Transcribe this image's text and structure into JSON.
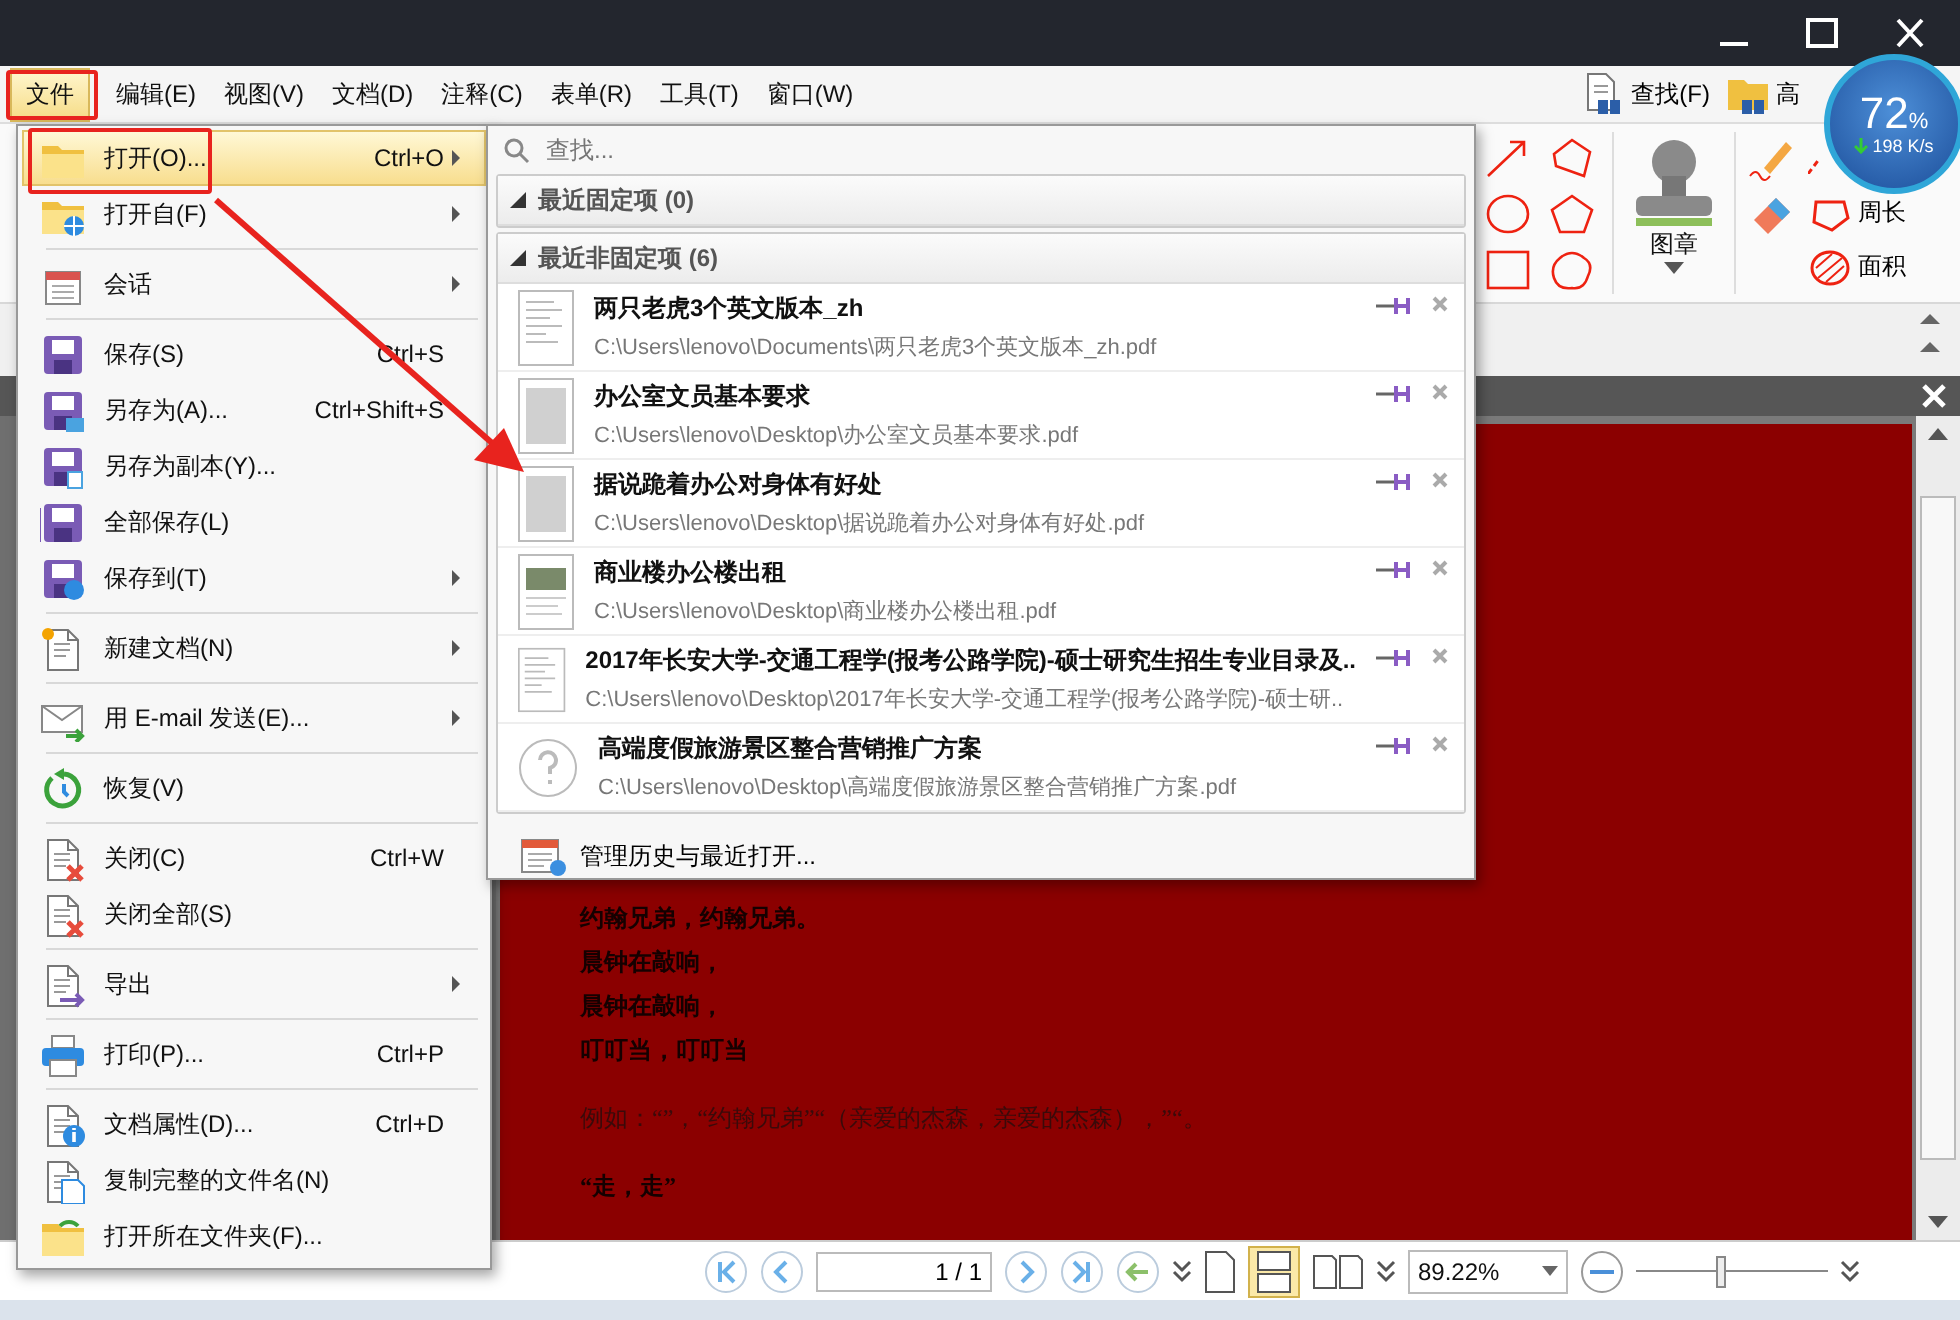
{
  "monitor": {
    "value": "72",
    "unit": "%",
    "speed": "198 K/s"
  },
  "menubar": [
    {
      "label": "文件",
      "selected": true
    },
    {
      "label": "编辑(E)",
      "selected": false
    },
    {
      "label": "视图(V)",
      "selected": false
    },
    {
      "label": "文档(D)",
      "selected": false
    },
    {
      "label": "注释(C)",
      "selected": false
    },
    {
      "label": "表单(R)",
      "selected": false
    },
    {
      "label": "工具(T)",
      "selected": false
    },
    {
      "label": "窗口(W)",
      "selected": false
    }
  ],
  "quick_tools": [
    {
      "label": "查找(F)"
    },
    {
      "label": "高"
    }
  ],
  "ribbon": {
    "stamp_label": "图章",
    "measure_labels": [
      "周长",
      "面积"
    ]
  },
  "file_menu": {
    "items": [
      {
        "kind": "item",
        "label": "打开(O)...",
        "shortcut": "Ctrl+O",
        "submenu": true,
        "selected": true
      },
      {
        "kind": "item",
        "label": "打开自(F)",
        "submenu": true,
        "selected": false
      },
      {
        "kind": "separator"
      },
      {
        "kind": "item",
        "label": "会话",
        "submenu": true,
        "selected": false
      },
      {
        "kind": "separator"
      },
      {
        "kind": "item",
        "label": "保存(S)",
        "shortcut": "Ctrl+S",
        "submenu": false,
        "selected": false
      },
      {
        "kind": "item",
        "label": "另存为(A)...",
        "shortcut": "Ctrl+Shift+S",
        "submenu": false,
        "selected": false
      },
      {
        "kind": "item",
        "label": "另存为副本(Y)...",
        "submenu": false,
        "selected": false
      },
      {
        "kind": "item",
        "label": "全部保存(L)",
        "submenu": false,
        "selected": false
      },
      {
        "kind": "item",
        "label": "保存到(T)",
        "submenu": true,
        "selected": false
      },
      {
        "kind": "separator"
      },
      {
        "kind": "item",
        "label": "新建文档(N)",
        "submenu": true,
        "selected": false
      },
      {
        "kind": "separator"
      },
      {
        "kind": "item",
        "label": "用 E-mail 发送(E)...",
        "submenu": true,
        "selected": false
      },
      {
        "kind": "separator"
      },
      {
        "kind": "item",
        "label": "恢复(V)",
        "submenu": false,
        "selected": false
      },
      {
        "kind": "separator"
      },
      {
        "kind": "item",
        "label": "关闭(C)",
        "shortcut": "Ctrl+W",
        "submenu": false,
        "selected": false
      },
      {
        "kind": "item",
        "label": "关闭全部(S)",
        "submenu": false,
        "selected": false
      },
      {
        "kind": "separator"
      },
      {
        "kind": "item",
        "label": "导出",
        "submenu": true,
        "selected": false
      },
      {
        "kind": "separator"
      },
      {
        "kind": "item",
        "label": "打印(P)...",
        "shortcut": "Ctrl+P",
        "submenu": false,
        "selected": false
      },
      {
        "kind": "separator"
      },
      {
        "kind": "item",
        "label": "文档属性(D)...",
        "shortcut": "Ctrl+D",
        "submenu": false,
        "selected": false
      },
      {
        "kind": "item",
        "label": "复制完整的文件名(N)",
        "submenu": false,
        "selected": false
      },
      {
        "kind": "item",
        "label": "打开所在文件夹(F)...",
        "submenu": false,
        "selected": false
      }
    ]
  },
  "recent_menu": {
    "search_placeholder": "查找...",
    "groups": [
      {
        "label": "最近固定项 (0)",
        "expanded": true
      },
      {
        "label": "最近非固定项 (6)",
        "expanded": true
      }
    ],
    "files": [
      {
        "name": "两只老虎3个英文版本_zh",
        "path": "C:\\Users\\lenovo\\Documents\\两只老虎3个英文版本_zh.pdf",
        "kind": "text"
      },
      {
        "name": "办公室文员基本要求",
        "path": "C:\\Users\\lenovo\\Desktop\\办公室文员基本要求.pdf",
        "kind": "dense"
      },
      {
        "name": "据说跪着办公对身体有好处",
        "path": "C:\\Users\\lenovo\\Desktop\\据说跪着办公对身体有好处.pdf",
        "kind": "dense"
      },
      {
        "name": "商业楼办公楼出租",
        "path": "C:\\Users\\lenovo\\Desktop\\商业楼办公楼出租.pdf",
        "kind": "photo"
      },
      {
        "name": "2017年长安大学-交通工程学(报考公路学院)-硕士研究生招生专业目录及..",
        "path": "C:\\Users\\lenovo\\Desktop\\2017年长安大学-交通工程学(报考公路学院)-硕士研..",
        "kind": "text"
      },
      {
        "name": "高端度假旅游景区整合营销推广方案",
        "path": "C:\\Users\\lenovo\\Desktop\\高端度假旅游景区整合营销推广方案.pdf",
        "kind": "unknown"
      }
    ],
    "footer": "管理历史与最近打开..."
  },
  "document": {
    "lines": [
      {
        "text": "约翰兄弟，约翰兄弟。",
        "bold": true
      },
      {
        "text": "晨钟在敲响，",
        "bold": true
      },
      {
        "text": "晨钟在敲响，",
        "bold": true
      },
      {
        "text": "叮叮当，叮叮当",
        "bold": true
      },
      {
        "text": "例如：“”，“约翰兄弟”“（亲爱的杰森，亲爱的杰森），”“。",
        "bold": false
      },
      {
        "text": "“走，走”",
        "bold": true
      }
    ]
  },
  "bottom_toolbar": {
    "page": "1 / 1",
    "zoom": "89.22%",
    "zoom_slider": {
      "level": 0.44
    }
  }
}
